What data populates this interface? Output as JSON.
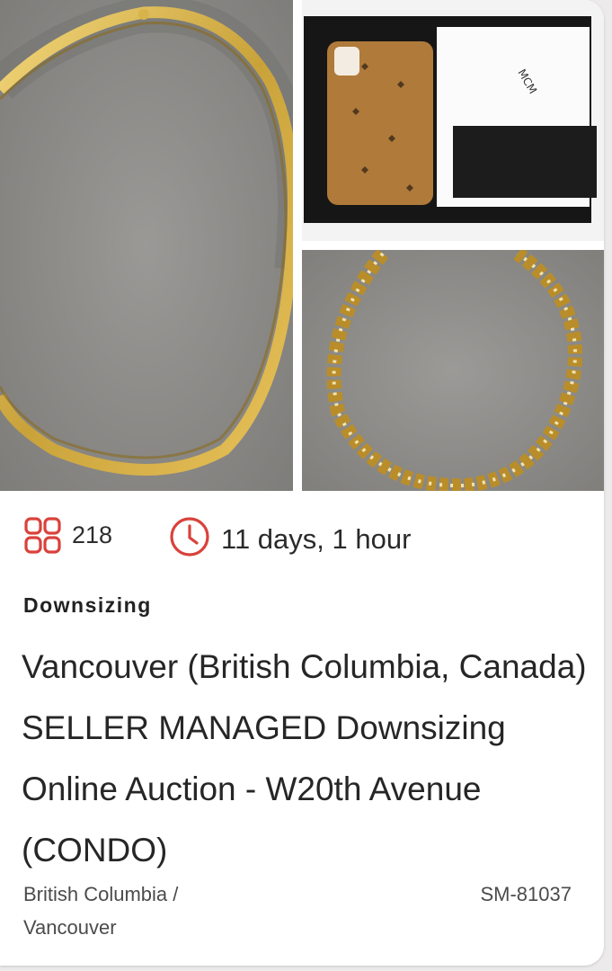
{
  "listing": {
    "images": [
      {
        "subject": "gold omega necklace on grey display"
      },
      {
        "subject": "MCM phone case with box"
      },
      {
        "subject": "gold filigree link necklace"
      }
    ],
    "lot_count": "218",
    "time_remaining": "11 days, 1 hour",
    "category": "Downsizing",
    "title": "Vancouver (British Columbia, Canada) SELLER MANAGED Downsizing Online Auction - W20th Avenue (CONDO)",
    "region": "British Columbia / Vancouver",
    "auction_code": "SM-81037",
    "icons": {
      "lots": "grid-icon",
      "time": "clock-icon"
    },
    "accent_color": "#d9423b"
  }
}
